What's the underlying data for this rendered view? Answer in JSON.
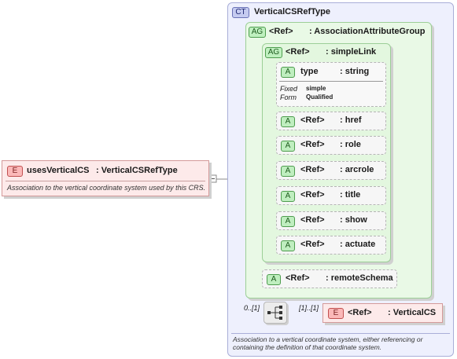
{
  "complex_type": {
    "badge": "CT",
    "name": "VerticalCSRefType",
    "doc": "Association to a vertical coordinate system, either referencing or containing the definition of that coordinate system."
  },
  "attribute_group_outer": {
    "badge": "AG",
    "ref": "<Ref>",
    "name": ": AssociationAttributeGroup"
  },
  "attribute_group_inner": {
    "badge": "AG",
    "ref": "<Ref>",
    "name": ": simpleLink"
  },
  "type_attr": {
    "badge": "A",
    "name": "type",
    "type": ": string",
    "fixed_label": "Fixed",
    "fixed_value": "simple",
    "form_label": "Form",
    "form_value": "Qualified"
  },
  "attributes": [
    {
      "badge": "A",
      "ref": "<Ref>",
      "name": ": href"
    },
    {
      "badge": "A",
      "ref": "<Ref>",
      "name": ": role"
    },
    {
      "badge": "A",
      "ref": "<Ref>",
      "name": ": arcrole"
    },
    {
      "badge": "A",
      "ref": "<Ref>",
      "name": ": title"
    },
    {
      "badge": "A",
      "ref": "<Ref>",
      "name": ": show"
    },
    {
      "badge": "A",
      "ref": "<Ref>",
      "name": ": actuate"
    }
  ],
  "remote_schema": {
    "badge": "A",
    "ref": "<Ref>",
    "name": ": remoteSchema"
  },
  "element_uses": {
    "badge": "E",
    "name": "usesVerticalCS",
    "type": ": VerticalCSRefType",
    "doc": "Association to the vertical coordinate system used by this CRS."
  },
  "sequence": {
    "min_occurs": "0..[1]",
    "child_occurs": "[1]..[1]"
  },
  "element_vcs": {
    "badge": "E",
    "ref": "<Ref>",
    "name": ": VerticalCS"
  }
}
